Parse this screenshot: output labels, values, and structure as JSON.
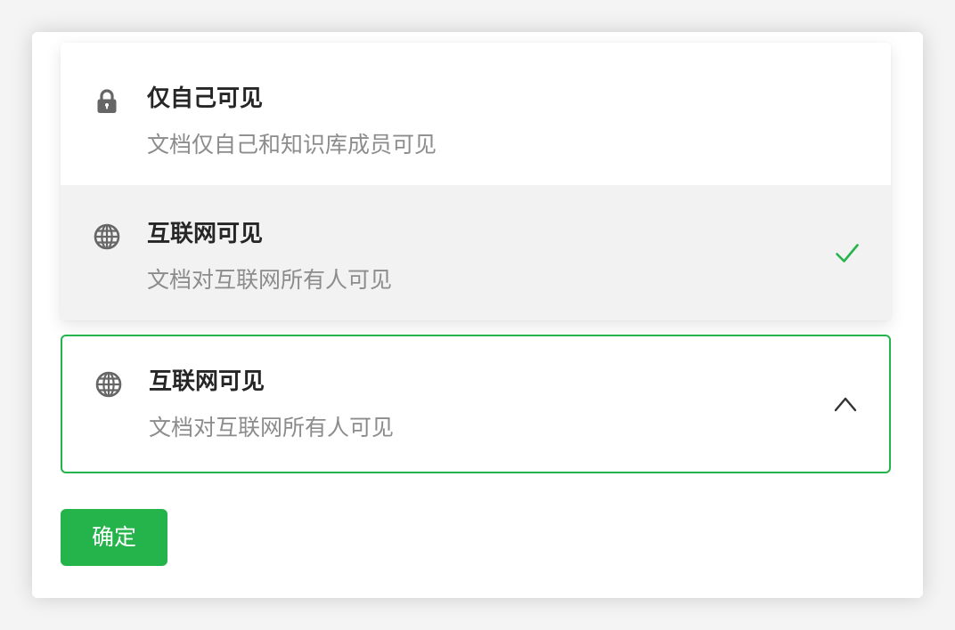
{
  "dropdown": {
    "options": [
      {
        "icon": "lock-icon",
        "title": "仅自己可见",
        "description": "文档仅自己和知识库成员可见",
        "selected": false
      },
      {
        "icon": "globe-icon",
        "title": "互联网可见",
        "description": "文档对互联网所有人可见",
        "selected": true
      }
    ]
  },
  "select": {
    "icon": "globe-icon",
    "title": "互联网可见",
    "description": "文档对互联网所有人可见",
    "expanded": true
  },
  "actions": {
    "confirm_label": "确定"
  },
  "colors": {
    "accent": "#25b34b",
    "selected_row": "#f2f2f2",
    "title_text": "#262626",
    "description_text": "#8c8c8c",
    "icon": "#666666"
  }
}
